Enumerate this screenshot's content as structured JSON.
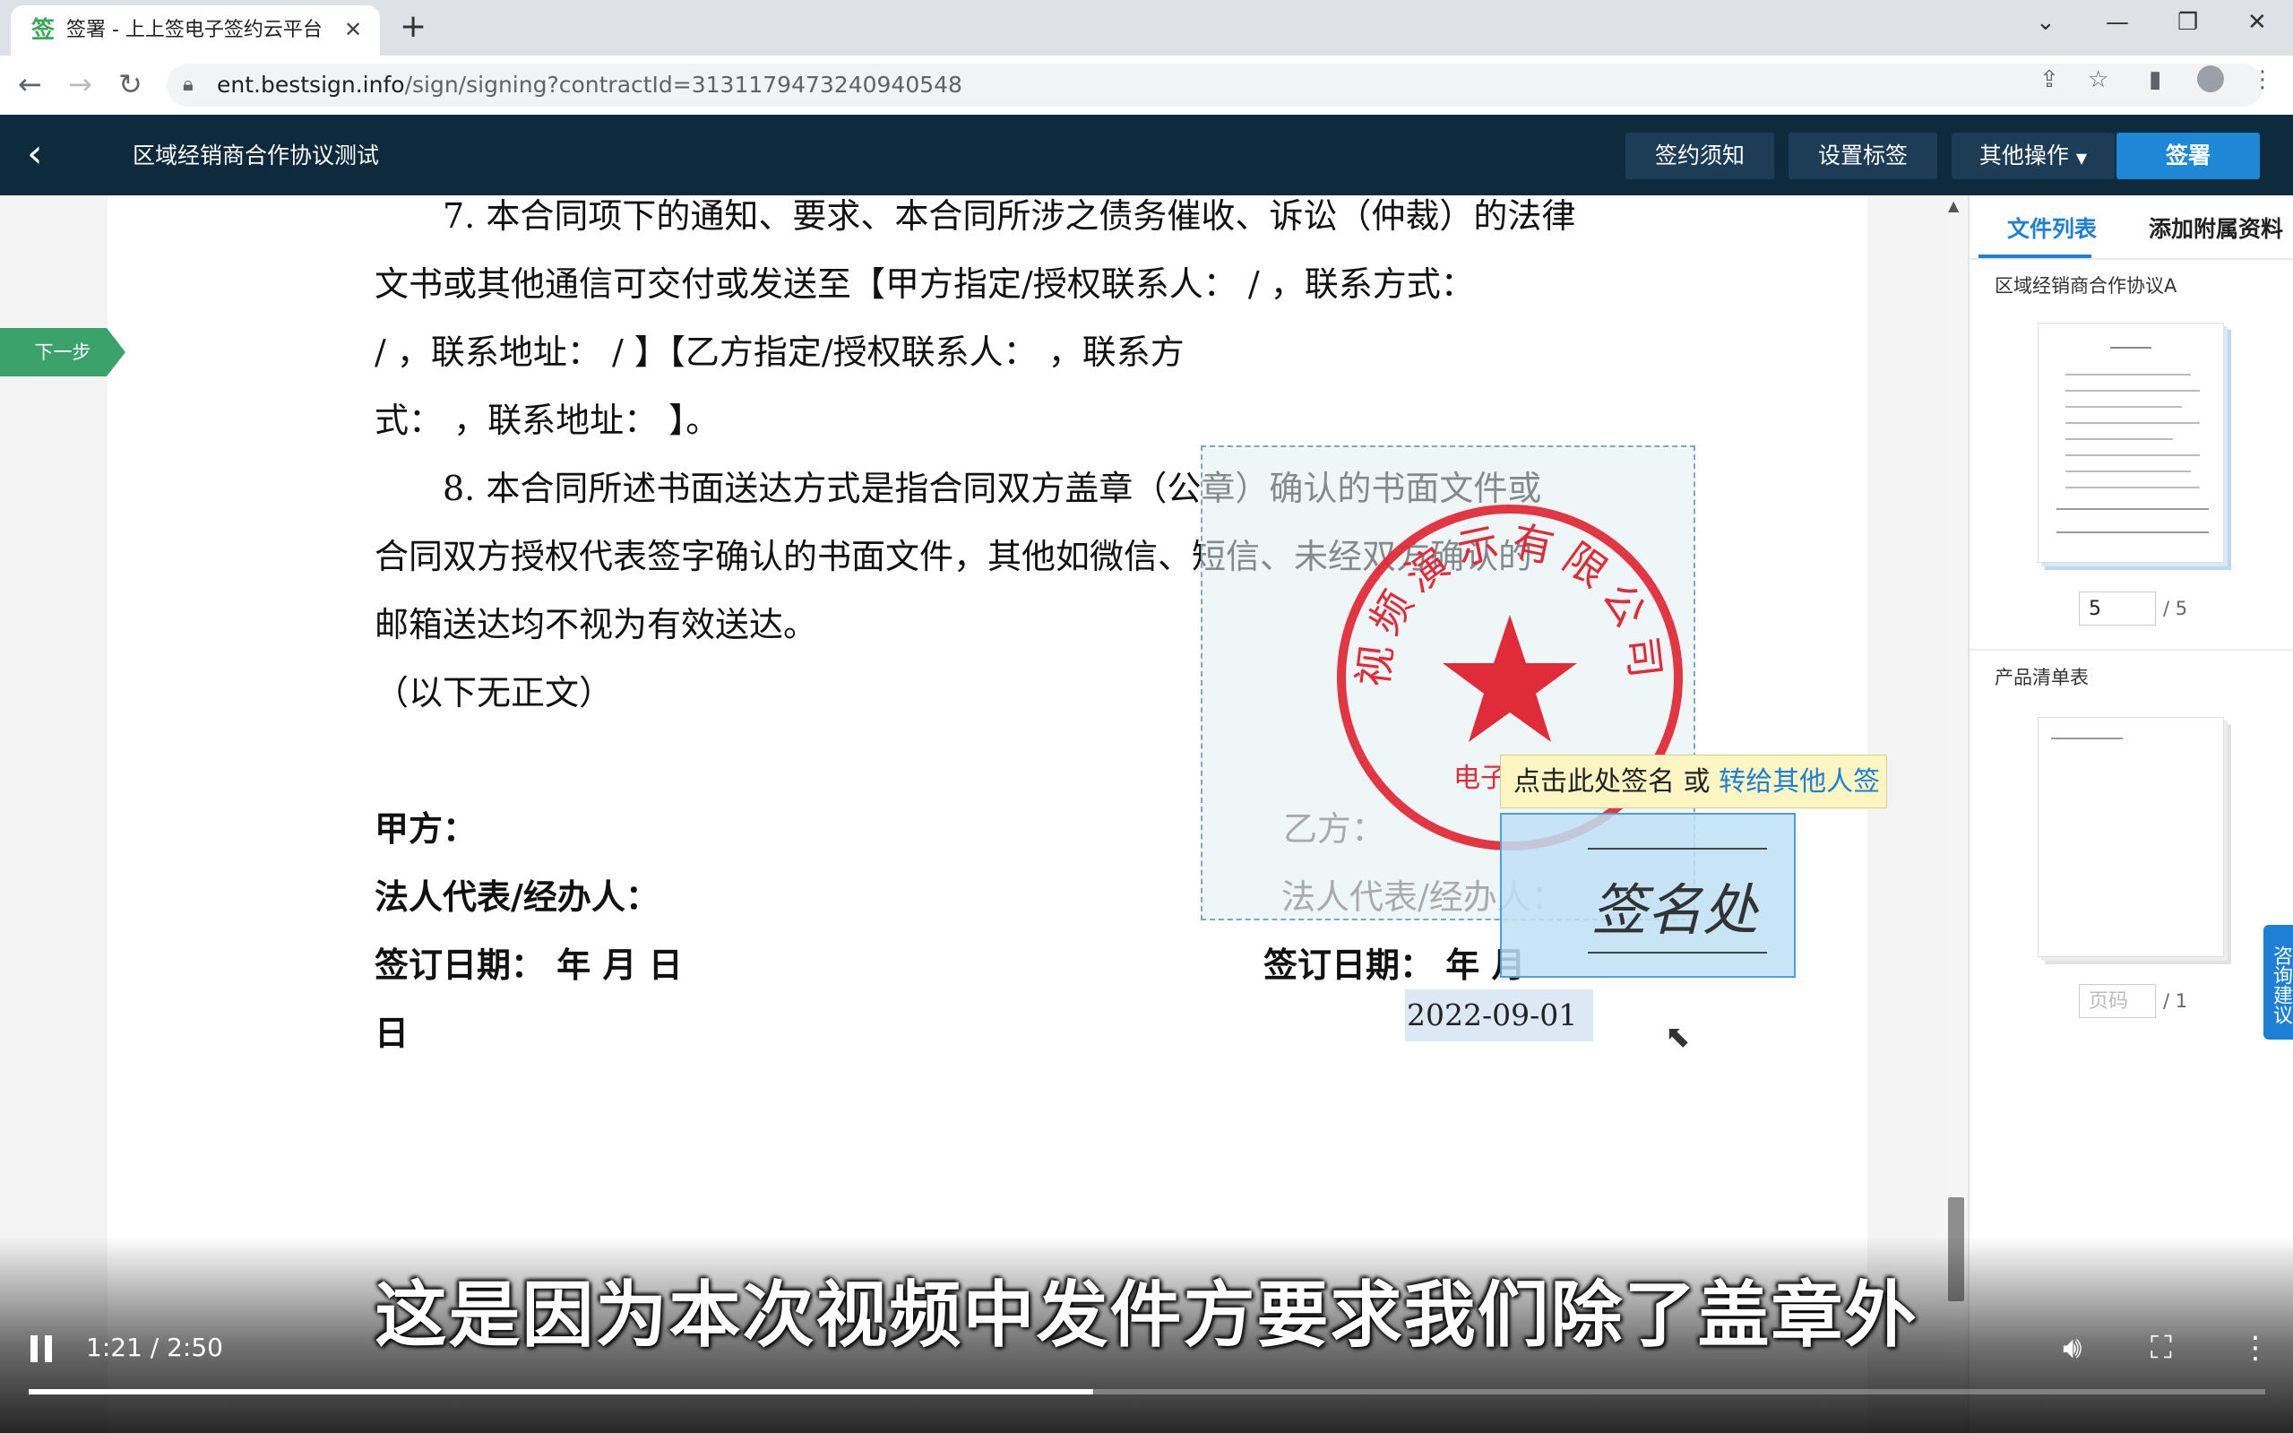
{
  "browser": {
    "tab_title": "签署 - 上上签电子签约云平台",
    "favicon": "签",
    "url_host": "ent.bestsign.info",
    "url_path": "/sign/signing?contractId=3131179473240940548"
  },
  "header": {
    "title": "区域经销商合作协议测试",
    "buttons": {
      "notice": "签约须知",
      "set_tag": "设置标签",
      "other_ops": "其他操作",
      "sign": "签署"
    }
  },
  "side": {
    "next_step": "下一步"
  },
  "document": {
    "lines": [
      "7. 本合同项下的通知、要求、本合同所涉之债务催收、诉讼（仲裁）的法律",
      "文书或其他通信可交付或发送至【甲方指定/授权联系人：    /    ，联系方式：",
      "/       ，联系地址：    /      】【乙方指定/授权联系人：               ，联系方",
      "式：                        ，联系地址：                                 】。",
      "8. 本合同所述书面送达方式是指合同双方盖章（公章）确认的书面文件或",
      "合同双方授权代表签字确认的书面文件，其他如微信、短信、未经双方确认的",
      "邮箱送达均不视为有效送达。",
      "（以下无正文）"
    ],
    "party_a": "甲方：",
    "legal_rep_a": "法人代表/经办人：",
    "sign_date_a": "签订日期：      年    月    日",
    "sign_date_a_day": "日",
    "party_b": "乙方：",
    "legal_rep_b": "法人代表/经办人：",
    "sign_date_b": "签订日期：     年    月",
    "stamp_text": "视频演示有限公司",
    "stamp_sub": "电子",
    "tooltip_text": "点击此处签名 或 ",
    "tooltip_link": "转给其他人签",
    "sign_placeholder": "签名处",
    "date_value": "2022-09-01"
  },
  "right_panel": {
    "tab_files": "文件列表",
    "tab_attach": "添加附属资料",
    "doc1_name": "区域经销商合作协议A",
    "doc1_page": "5",
    "doc1_total": "/ 5",
    "doc2_name": "产品清单表",
    "doc2_page_placeholder": "页码",
    "doc2_total": "/ 1",
    "consult": "咨询建议"
  },
  "video": {
    "subtitle": "这是因为本次视频中发件方要求我们除了盖章外",
    "time": "1:21 / 2:50",
    "progress": 0.476
  },
  "colors": {
    "header_bg": "#0e2a3d",
    "primary": "#1f88d6",
    "next_step": "#3aa26a",
    "stamp_red": "#e02b38"
  }
}
